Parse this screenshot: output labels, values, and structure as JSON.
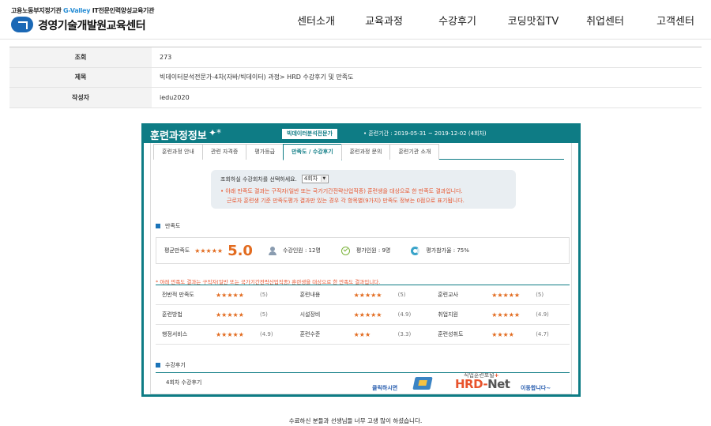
{
  "header": {
    "brand_top_prefix": "고용노동부지정기관 ",
    "brand_top_gvalley": "G-Valley",
    "brand_top_suffix": " IT전문인력양성교육기관",
    "brand_name": "경영기술개발원교육센터",
    "nav": [
      "센터소개",
      "교육과정",
      "수강후기",
      "코딩맛집TV",
      "취업센터",
      "고객센터"
    ]
  },
  "post": {
    "views_label": "조회",
    "views": "273",
    "title_label": "제목",
    "title": "빅데이터분석전문가-4차(자바/빅데이터) 과정> HRD 수강후기 및 만족도",
    "author_label": "작성자",
    "author": "iedu2020"
  },
  "panel": {
    "title": "훈련과정정보",
    "sparkle": "✦*",
    "course": "빅데이터분석전문가",
    "period": "• 훈련기간 : 2019-05-31 ~ 2019-12-02 (4회차)",
    "tabs": [
      "훈련과정 안내",
      "관련 자격증",
      "평가등급",
      "만족도 / 수강후기",
      "훈련과정 문의",
      "훈련기관 소개"
    ],
    "active_tab": "만족도 / 수강후기",
    "filter_label": "조회하실 수강회차를 선택하세요.",
    "filter_value": "4회차",
    "filter_note_1": "• 아래 만족도 결과는 구직자(일반 또는 국가기간전략산업직종) 훈련생을 대상으로 한 만족도 결과입니다.",
    "filter_note_2": "근로자 훈련생 기준 만족도평가 결과만 있는 경우 각 항목별(9가지) 만족도 정보는 0점으로 표기됩니다.",
    "satisfaction_title": "만족도",
    "summary": {
      "avg_label": "평균만족도",
      "avg_stars": "★★★★★",
      "avg_score": "5.0",
      "enrolled": "수강인원 : 12명",
      "evaluated": "평가인원 : 9명",
      "participation": "평가참가율 : 75%"
    },
    "note_red": "* 아래 만족도 결과는 구직자(일반 또는 국가기간전략산업직종) 훈련생을 대상으로 한 만족도 결과입니다.",
    "ratings": [
      [
        {
          "name": "전반적 만족도",
          "stars": "★★★★★",
          "score": "(5)"
        },
        {
          "name": "훈련내용",
          "stars": "★★★★★",
          "score": "(5)"
        },
        {
          "name": "훈련교사",
          "stars": "★★★★★",
          "score": "(5)"
        }
      ],
      [
        {
          "name": "훈련방법",
          "stars": "★★★★★",
          "score": "(5)"
        },
        {
          "name": "시설장비",
          "stars": "★★★★★",
          "score": "(4.9)"
        },
        {
          "name": "취업지원",
          "stars": "★★★★★",
          "score": "(4.9)"
        }
      ],
      [
        {
          "name": "행정서비스",
          "stars": "★★★★★",
          "score": "(4.9)"
        },
        {
          "name": "훈련수준",
          "stars": "★★★",
          "score": "(3.3)"
        },
        {
          "name": "훈련성취도",
          "stars": "★★★★",
          "score": "(4.7)"
        }
      ]
    ],
    "review_title": "수강후기",
    "review_round": "4회차 수강후기",
    "hrd": {
      "click": "클릭하시면",
      "small_label": "직업훈련포털",
      "small_plus": "+",
      "logo_hrd": "HRD-",
      "logo_net": "Net",
      "go": "이동합니다~"
    }
  },
  "footer_text": "수료하신 분들과 선생님들 너무 고생 많이 하셨습니다."
}
